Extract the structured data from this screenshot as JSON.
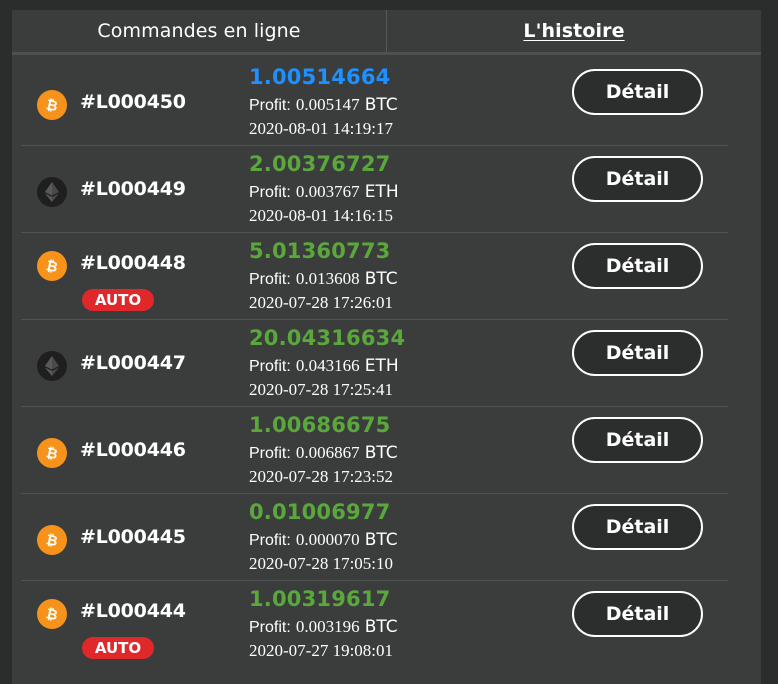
{
  "tabs": {
    "online_orders": "Commandes en ligne",
    "history": "L'histoire",
    "active": "history"
  },
  "colors": {
    "btc": "#f7931a",
    "eth": "#1f1f1f",
    "amount_green": "#5aa83c",
    "amount_blue": "#1e90ff",
    "auto_badge": "#e0282b"
  },
  "orders": [
    {
      "coin": "btc",
      "coin_icon": "bitcoin-icon",
      "id": "#L000450",
      "auto": "",
      "amount": "1.00514664",
      "amount_color": "blue",
      "profit_label": "Profit:",
      "profit_value": "0.005147",
      "currency": "BTC",
      "date": "2020-08-01 14:19:17",
      "detail": "Détail"
    },
    {
      "coin": "eth",
      "coin_icon": "ethereum-icon",
      "id": "#L000449",
      "auto": "",
      "amount": "2.00376727",
      "amount_color": "green",
      "profit_label": "Profit:",
      "profit_value": "0.003767",
      "currency": "ETH",
      "date": "2020-08-01 14:16:15",
      "detail": "Détail"
    },
    {
      "coin": "btc",
      "coin_icon": "bitcoin-icon",
      "id": "#L000448",
      "auto": "AUTO",
      "amount": "5.01360773",
      "amount_color": "green",
      "profit_label": "Profit:",
      "profit_value": "0.013608",
      "currency": "BTC",
      "date": "2020-07-28 17:26:01",
      "detail": "Détail"
    },
    {
      "coin": "eth",
      "coin_icon": "ethereum-icon",
      "id": "#L000447",
      "auto": "",
      "amount": "20.04316634",
      "amount_color": "green",
      "profit_label": "Profit:",
      "profit_value": "0.043166",
      "currency": "ETH",
      "date": "2020-07-28 17:25:41",
      "detail": "Détail"
    },
    {
      "coin": "btc",
      "coin_icon": "bitcoin-icon",
      "id": "#L000446",
      "auto": "",
      "amount": "1.00686675",
      "amount_color": "green",
      "profit_label": "Profit:",
      "profit_value": "0.006867",
      "currency": "BTC",
      "date": "2020-07-28 17:23:52",
      "detail": "Détail"
    },
    {
      "coin": "btc",
      "coin_icon": "bitcoin-icon",
      "id": "#L000445",
      "auto": "",
      "amount": "0.01006977",
      "amount_color": "green",
      "profit_label": "Profit:",
      "profit_value": "0.000070",
      "currency": "BTC",
      "date": "2020-07-28 17:05:10",
      "detail": "Détail"
    },
    {
      "coin": "btc",
      "coin_icon": "bitcoin-icon",
      "id": "#L000444",
      "auto": "AUTO",
      "amount": "1.00319617",
      "amount_color": "green",
      "profit_label": "Profit:",
      "profit_value": "0.003196",
      "currency": "BTC",
      "date": "2020-07-27 19:08:01",
      "detail": "Détail"
    }
  ]
}
